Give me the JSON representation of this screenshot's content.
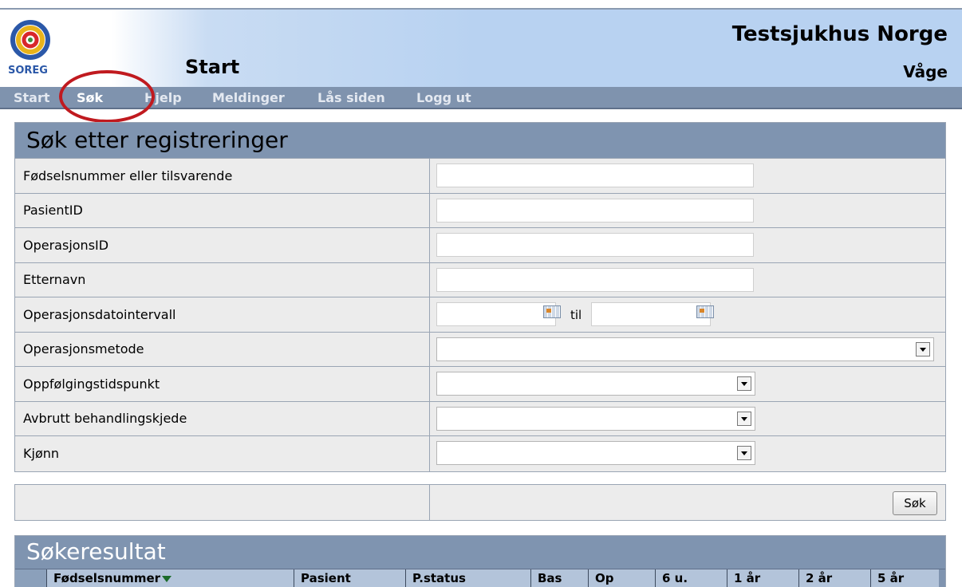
{
  "header": {
    "logo_text": "SOREG",
    "page_title": "Start",
    "org_name": "Testsjukhus Norge",
    "org_sub": "Våge"
  },
  "nav": {
    "items": [
      "Start",
      "Søk",
      "Hjelp",
      "Meldinger",
      "Lås siden",
      "Logg ut"
    ],
    "active": "Søk",
    "highlight_color": "#c01a1f"
  },
  "search": {
    "title": "Søk etter registreringer",
    "fields": {
      "fnr_label": "Fødselsnummer eller tilsvarende",
      "patient_id_label": "PasientID",
      "operation_id_label": "OperasjonsID",
      "lastname_label": "Etternavn",
      "date_interval_label": "Operasjonsdatointervall",
      "date_to_text": "til",
      "method_label": "Operasjonsmetode",
      "followup_label": "Oppfølgingstidspunkt",
      "aborted_label": "Avbrutt behandlingskjede",
      "gender_label": "Kjønn"
    },
    "button_label": "Søk"
  },
  "results": {
    "title": "Søkeresultat",
    "columns": [
      "Fødselsnummer",
      "Pasient",
      "P.status",
      "Bas",
      "Op",
      "6 u.",
      "1 år",
      "2 år",
      "5 år"
    ]
  },
  "colors": {
    "panel_header": "#7f94b0",
    "row_bg": "#ececec",
    "nav_bg": "#7f93ae"
  }
}
